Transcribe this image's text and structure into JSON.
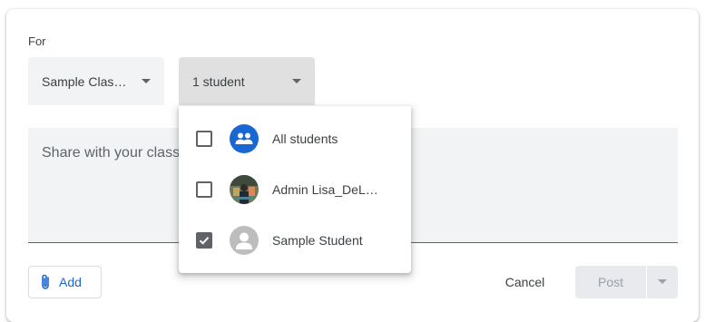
{
  "form": {
    "for_label": "For",
    "class_select": "Sample Clas…",
    "students_select": "1 student",
    "share_placeholder": "Share with your class",
    "add_label": "Add",
    "cancel_label": "Cancel",
    "post_label": "Post"
  },
  "dropdown": {
    "options": [
      {
        "label": "All students",
        "checked": false,
        "icon": "group-icon"
      },
      {
        "label": "Admin Lisa_DeL…",
        "checked": false,
        "icon": "profile-photo"
      },
      {
        "label": "Sample Student",
        "checked": true,
        "icon": "person-icon"
      }
    ]
  },
  "colors": {
    "accent": "#1967d2",
    "field_bg": "#f1f3f4",
    "text": "#3c4043"
  }
}
